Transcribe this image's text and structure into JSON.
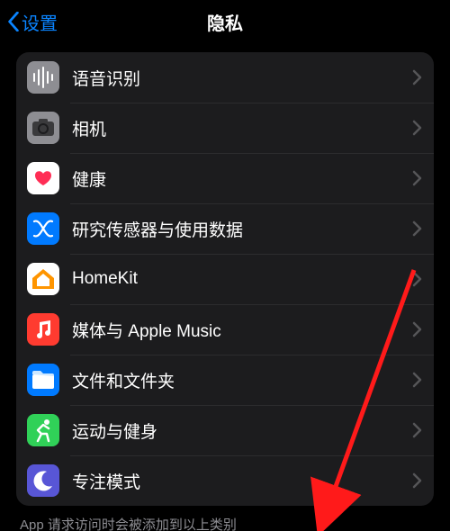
{
  "nav": {
    "back_label": "设置",
    "title": "隐私"
  },
  "rows": [
    {
      "id": "speech",
      "label": "语音识别",
      "icon_bg": "#8e8e93"
    },
    {
      "id": "camera",
      "label": "相机",
      "icon_bg": "#8e8e93"
    },
    {
      "id": "health",
      "label": "健康",
      "icon_bg": "#ffffff"
    },
    {
      "id": "research",
      "label": "研究传感器与使用数据",
      "icon_bg": "#007aff"
    },
    {
      "id": "homekit",
      "label": "HomeKit",
      "icon_bg": "#ffffff"
    },
    {
      "id": "media",
      "label": "媒体与 Apple Music",
      "icon_bg": "#ff3b30"
    },
    {
      "id": "files",
      "label": "文件和文件夹",
      "icon_bg": "#007aff"
    },
    {
      "id": "fitness",
      "label": "运动与健身",
      "icon_bg": "#30d158"
    },
    {
      "id": "focus",
      "label": "专注模式",
      "icon_bg": "#5856d6"
    }
  ],
  "footer": "App 请求访问时会被添加到以上类别"
}
